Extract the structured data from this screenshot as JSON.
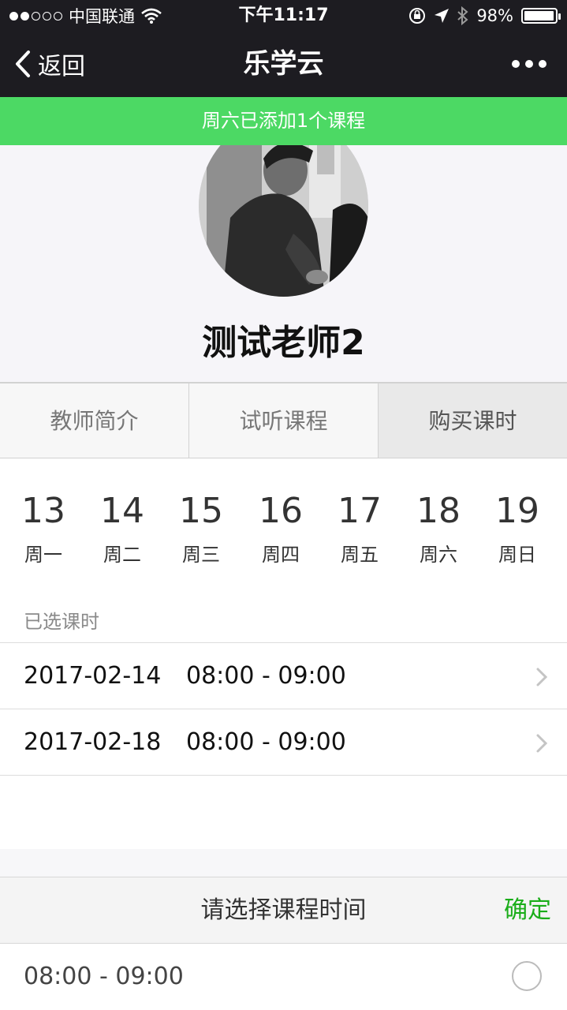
{
  "status_bar": {
    "carrier": "中国联通",
    "time": "下午11:17",
    "battery": "98%",
    "battery_level": 0.98,
    "signal_bars": 2
  },
  "nav": {
    "back_label": "返回",
    "title": "乐学云"
  },
  "toast": {
    "message": "周六已添加1个课程",
    "color": "#4cd964"
  },
  "teacher": {
    "name": "测试老师2"
  },
  "tabs": [
    {
      "label": "教师简介"
    },
    {
      "label": "试听课程"
    },
    {
      "label": "购买课时"
    }
  ],
  "week": [
    {
      "num": "13",
      "label": "周一"
    },
    {
      "num": "14",
      "label": "周二"
    },
    {
      "num": "15",
      "label": "周三"
    },
    {
      "num": "16",
      "label": "周四"
    },
    {
      "num": "17",
      "label": "周五"
    },
    {
      "num": "18",
      "label": "周六"
    },
    {
      "num": "19",
      "label": "周日"
    }
  ],
  "selected": {
    "label": "已选课时",
    "items": [
      {
        "date": "2017-02-14",
        "time": "08:00 - 09:00"
      },
      {
        "date": "2017-02-18",
        "time": "08:00 - 09:00"
      }
    ]
  },
  "picker": {
    "title": "请选择课程时间",
    "confirm": "确定",
    "confirm_color": "#1aad19",
    "options": [
      {
        "time": "08:00 - 09:00"
      }
    ]
  }
}
